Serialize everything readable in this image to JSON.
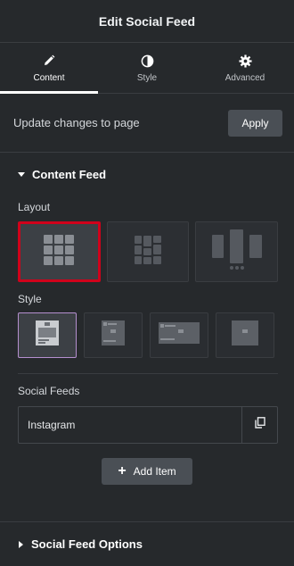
{
  "header": {
    "title": "Edit Social Feed"
  },
  "tabs": [
    {
      "label": "Content",
      "icon": "pencil-icon",
      "active": true
    },
    {
      "label": "Style",
      "icon": "half-circle-icon",
      "active": false
    },
    {
      "label": "Advanced",
      "icon": "gear-icon",
      "active": false
    }
  ],
  "update": {
    "label": "Update changes to page",
    "apply_label": "Apply"
  },
  "content_feed": {
    "title": "Content Feed",
    "layout_label": "Layout",
    "layout_options": [
      "grid-layout-icon",
      "masonry-layout-icon",
      "carousel-layout-icon"
    ],
    "layout_selected": 0,
    "style_label": "Style",
    "style_options": [
      "card-style-1-icon",
      "card-style-2-icon",
      "card-style-3-icon",
      "card-style-4-icon"
    ],
    "style_selected": 0,
    "social_feeds_label": "Social Feeds",
    "feeds": [
      {
        "title": "Instagram"
      }
    ],
    "add_item_label": "Add Item"
  },
  "social_feed_options": {
    "title": "Social Feed Options"
  },
  "colors": {
    "background": "#26292c",
    "button": "#4a4f55",
    "selected_layout_border": "#d0021b",
    "selected_style_border": "#b58fcf"
  }
}
